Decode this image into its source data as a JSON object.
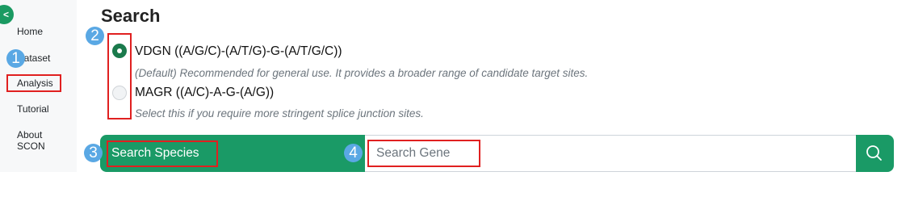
{
  "sidebar": {
    "collapse_label": "<",
    "items": [
      {
        "label": "Home"
      },
      {
        "label": "Dataset"
      },
      {
        "label": "Analysis"
      },
      {
        "label": "Tutorial"
      },
      {
        "label": "About SCON"
      }
    ]
  },
  "main": {
    "title": "Search",
    "options": [
      {
        "label": "VDGN ((A/G/C)-(A/T/G)-G-(A/T/G/C))",
        "description": "(Default) Recommended for general use. It provides a broader range of candidate target sites.",
        "selected": true
      },
      {
        "label": "MAGR ((A/C)-A-G-(A/G))",
        "description": "Select this if you require more stringent splice junction sites.",
        "selected": false
      }
    ],
    "search": {
      "species_placeholder": "Search Species",
      "gene_placeholder": "Search Gene",
      "button_icon": "search-icon"
    }
  },
  "annotations": {
    "badges": [
      "1",
      "2",
      "3",
      "4"
    ],
    "badge_color": "#5aa8e4",
    "box_color": "#e02020"
  },
  "colors": {
    "accent": "#1a9a66",
    "radio_checked": "#1a7a4c"
  }
}
